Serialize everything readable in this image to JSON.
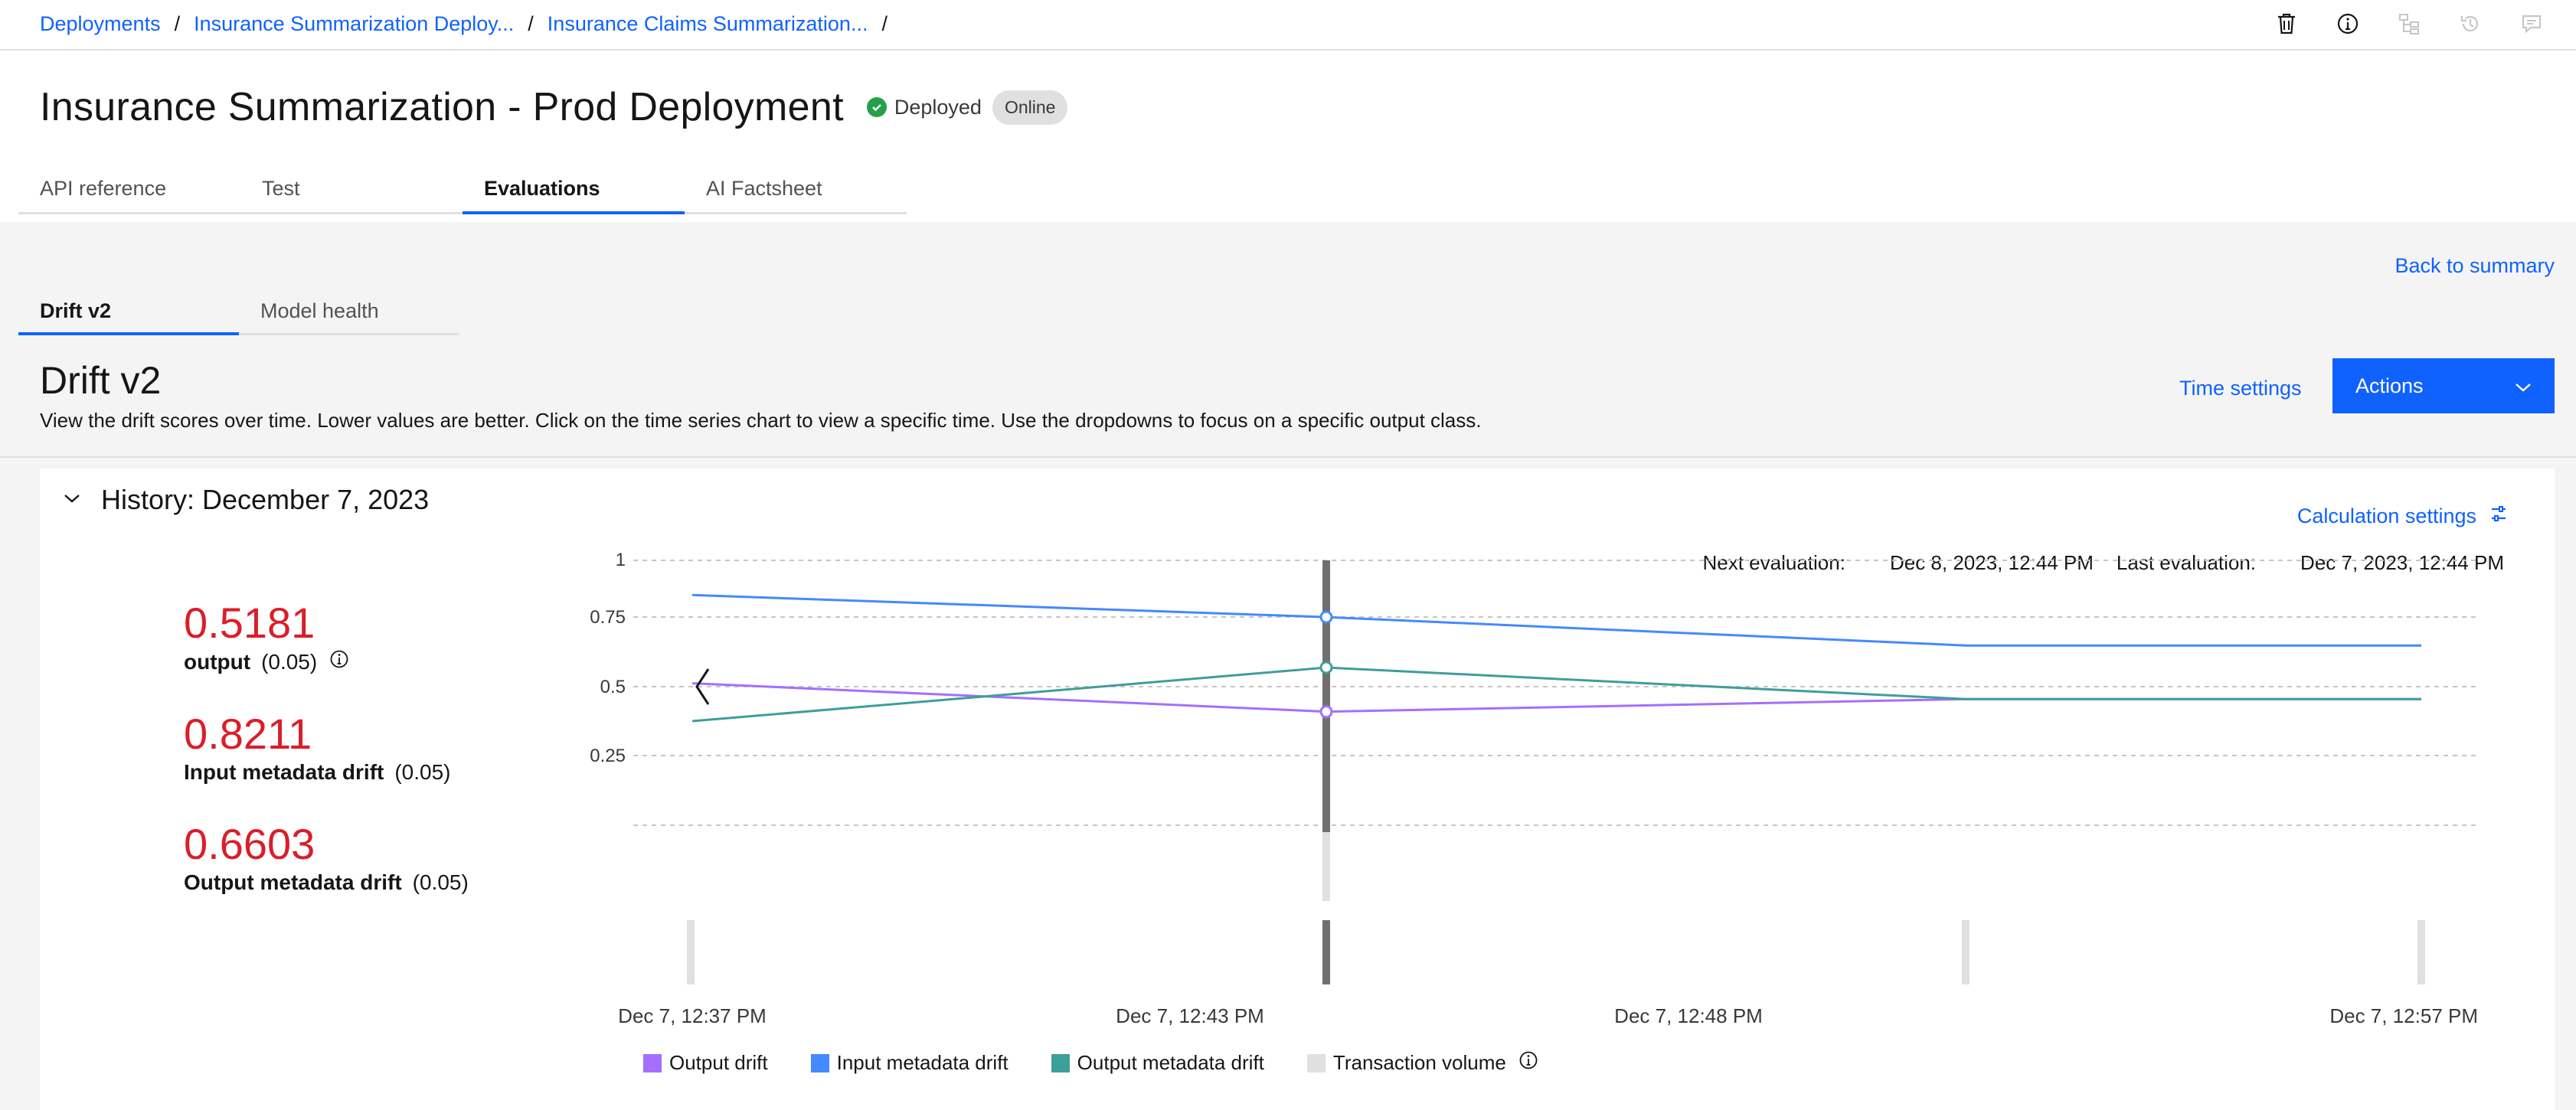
{
  "breadcrumb": [
    "Deployments",
    "Insurance Summarization Deploy...",
    "Insurance Claims Summarization...",
    ""
  ],
  "header": {
    "title": "Insurance Summarization - Prod Deployment",
    "status": "Deployed",
    "badge": "Online"
  },
  "tabs": [
    "API reference",
    "Test",
    "Evaluations",
    "AI Factsheet"
  ],
  "active_tab": "Evaluations",
  "back_link": "Back to summary",
  "subtabs": [
    "Drift v2",
    "Model health"
  ],
  "section": {
    "title": "Drift v2",
    "description": "View the drift scores over time. Lower values are better. Click on the time series chart to view a specific time. Use the dropdowns to focus on a specific output class.",
    "time_settings": "Time settings",
    "actions": "Actions"
  },
  "card": {
    "title": "History: December 7, 2023",
    "calc_settings": "Calculation settings",
    "next_eval_label": "Next evaluation:",
    "next_eval_value": "Dec 8, 2023, 12:44 PM",
    "last_eval_label": "Last evaluation:",
    "last_eval_value": "Dec 7, 2023, 12:44 PM"
  },
  "metrics": [
    {
      "value": "0.5181",
      "name": "output",
      "threshold": "(0.05)",
      "info": true
    },
    {
      "value": "0.8211",
      "name": "Input metadata drift",
      "threshold": "(0.05)",
      "info": false
    },
    {
      "value": "0.6603",
      "name": "Output metadata drift",
      "threshold": "(0.05)",
      "info": false
    }
  ],
  "colors": {
    "accent": "#0f62fe",
    "alert": "#da1e28",
    "output_drift": "#a56eff",
    "input_metadata_drift": "#4589ff",
    "output_metadata_drift": "#3e9e9a",
    "transaction_volume": "#e0e0e0",
    "selection": "#6f6f6f"
  },
  "chart_data": {
    "type": "line",
    "y_ticks": [
      "1",
      "0.75",
      "0.5",
      "0.25"
    ],
    "ylim": [
      0,
      1
    ],
    "grid": true,
    "x_ticks": [
      "Dec 7, 12:37 PM",
      "Dec 7, 12:43 PM",
      "Dec 7, 12:48 PM",
      "Dec 7, 12:57 PM"
    ],
    "x": [
      "12:37",
      "12:44",
      "12:53",
      "12:59"
    ],
    "selected_index": 1,
    "series": [
      {
        "name": "Output drift",
        "color": "#a56eff",
        "values": [
          0.61,
          0.52,
          0.56,
          0.56
        ]
      },
      {
        "name": "Input metadata drift",
        "color": "#4589ff",
        "values": [
          0.89,
          0.82,
          0.73,
          0.73
        ]
      },
      {
        "name": "Output metadata drift",
        "color": "#3e9e9a",
        "values": [
          0.49,
          0.66,
          0.56,
          0.56
        ]
      }
    ],
    "transaction_volume": {
      "name": "Transaction volume",
      "values": [
        1,
        1,
        1,
        1
      ]
    },
    "legend": [
      "Output drift",
      "Input metadata drift",
      "Output metadata drift",
      "Transaction volume"
    ]
  }
}
